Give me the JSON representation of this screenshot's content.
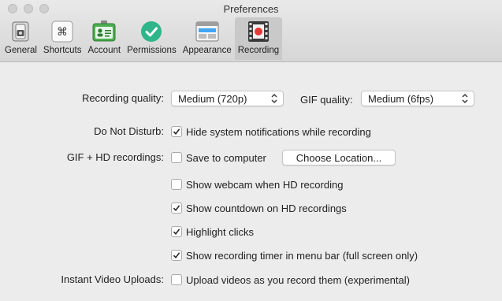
{
  "window": {
    "title": "Preferences",
    "traffic_lights": [
      "close",
      "minimize",
      "zoom"
    ]
  },
  "toolbar": {
    "active_tab": "Recording",
    "items": [
      {
        "label": "General",
        "icon": "switch-icon"
      },
      {
        "label": "Shortcuts",
        "icon": "command-key-icon"
      },
      {
        "label": "Account",
        "icon": "id-card-icon"
      },
      {
        "label": "Permissions",
        "icon": "checkmark-circle-icon"
      },
      {
        "label": "Appearance",
        "icon": "window-layout-icon"
      },
      {
        "label": "Recording",
        "icon": "film-record-icon"
      }
    ]
  },
  "recording": {
    "quality_label": "Recording quality:",
    "quality_value": "Medium (720p)",
    "gif_quality_label": "GIF quality:",
    "gif_quality_value": "Medium (6fps)",
    "dnd_label": "Do Not Disturb:",
    "dnd_option": {
      "text": "Hide system notifications while recording",
      "checked": true
    },
    "gif_hd_label": "GIF + HD recordings:",
    "save_option": {
      "text": "Save to computer",
      "checked": false
    },
    "choose_location_button": "Choose Location...",
    "options": [
      {
        "text": "Show webcam when HD recording",
        "checked": false
      },
      {
        "text": "Show countdown on HD recordings",
        "checked": true
      },
      {
        "text": "Highlight clicks",
        "checked": true
      },
      {
        "text": "Show recording timer in menu bar (full screen only)",
        "checked": true
      }
    ],
    "instant_label": "Instant Video Uploads:",
    "instant_option": {
      "text": "Upload videos as you record them (experimental)",
      "checked": false
    }
  },
  "colors": {
    "window_bg": "#ececec",
    "toolbar_active": "#c9c9c9",
    "permissions_green": "#2fb58a",
    "record_red": "#e53935"
  }
}
